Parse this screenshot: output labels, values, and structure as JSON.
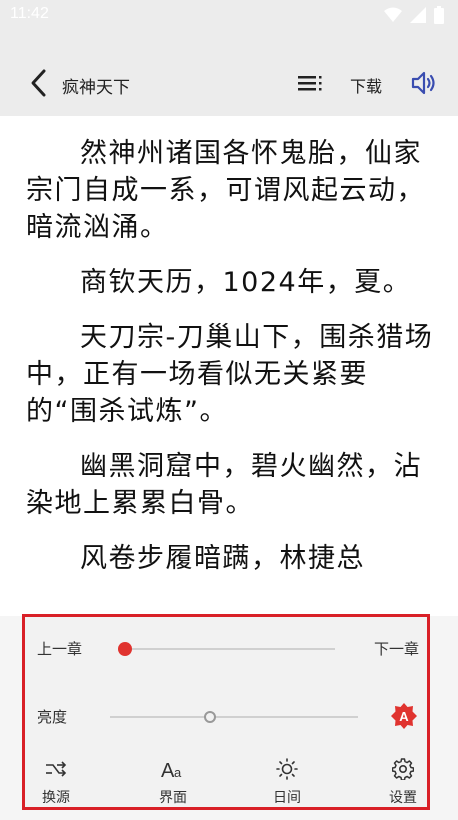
{
  "status_bar": {
    "time": "11:42"
  },
  "toolbar": {
    "title": "疯神天下",
    "download_label": "下载"
  },
  "content": {
    "paragraphs": [
      "然神州诸国各怀鬼胎，仙家宗门自成一系，可谓风起云动，暗流汹涌。",
      "商钦天历，1024年，夏。",
      "天刀宗-刀巢山下，围杀猎场中，正有一场看似无关紧要的“围杀试炼”。",
      "幽黑洞窟中，碧火幽然，沾染地上累累白骨。",
      "风卷步履暗蹒，林捷总"
    ]
  },
  "panel": {
    "prev_chapter": "上一章",
    "next_chapter": "下一章",
    "chapter_progress": 0.0,
    "brightness_label": "亮度",
    "brightness_level": 0.4,
    "auto_badge": "A",
    "buttons": [
      {
        "label": "换源",
        "icon": "shuffle-icon"
      },
      {
        "label": "界面",
        "icon": "font-icon"
      },
      {
        "label": "日间",
        "icon": "sun-icon"
      },
      {
        "label": "设置",
        "icon": "gear-icon"
      }
    ]
  },
  "colors": {
    "accent": "#e0332f",
    "highlight_border": "#d92027",
    "icon_blue": "#3a4db0"
  }
}
